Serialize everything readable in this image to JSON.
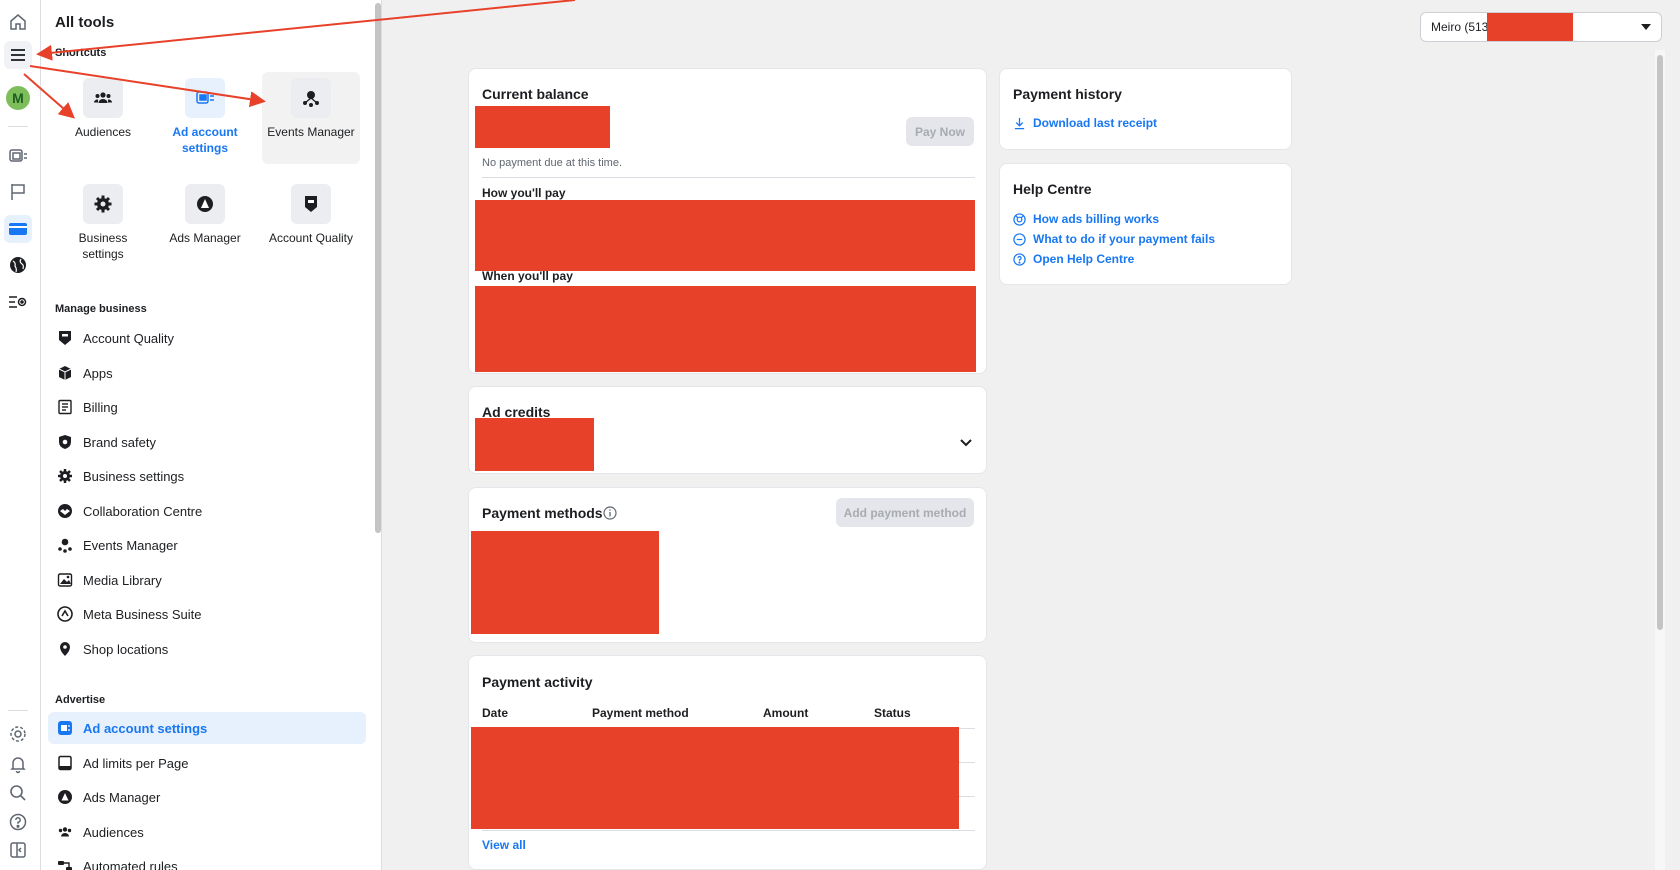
{
  "rail": {
    "avatar_letter": "M",
    "icons": [
      "home-icon",
      "menu-icon",
      "avatar",
      "ad-account-icon",
      "flag-icon",
      "billing-icon",
      "globe-icon",
      "list-settings-icon",
      "settings-icon",
      "bell-icon",
      "search-icon",
      "help-icon",
      "collapse-panel-icon"
    ]
  },
  "tools": {
    "title": "All tools",
    "shortcuts_title": "Shortcuts",
    "shortcuts": [
      {
        "label": "Audiences",
        "icon": "audiences-icon"
      },
      {
        "label": "Ad account settings",
        "icon": "ad-account-settings-icon",
        "active": true
      },
      {
        "label": "Events Manager",
        "icon": "events-manager-icon"
      },
      {
        "label": "Business settings",
        "icon": "gear-icon"
      },
      {
        "label": "Ads Manager",
        "icon": "ads-manager-icon"
      },
      {
        "label": "Account Quality",
        "icon": "shield-icon"
      }
    ],
    "manage_business_title": "Manage business",
    "manage_business": [
      {
        "label": "Account Quality",
        "icon": "shield-icon"
      },
      {
        "label": "Apps",
        "icon": "cube-icon"
      },
      {
        "label": "Billing",
        "icon": "receipt-icon"
      },
      {
        "label": "Brand safety",
        "icon": "brand-safety-icon"
      },
      {
        "label": "Business settings",
        "icon": "gear-icon"
      },
      {
        "label": "Collaboration Centre",
        "icon": "handshake-icon"
      },
      {
        "label": "Events Manager",
        "icon": "events-manager-icon"
      },
      {
        "label": "Media Library",
        "icon": "image-icon"
      },
      {
        "label": "Meta Business Suite",
        "icon": "meta-suite-icon"
      },
      {
        "label": "Shop locations",
        "icon": "pin-icon"
      }
    ],
    "advertise_title": "Advertise",
    "advertise": [
      {
        "label": "Ad account settings",
        "icon": "ad-account-settings-icon",
        "active": true
      },
      {
        "label": "Ad limits per Page",
        "icon": "tablet-icon"
      },
      {
        "label": "Ads Manager",
        "icon": "ads-manager-icon"
      },
      {
        "label": "Audiences",
        "icon": "audiences-icon"
      },
      {
        "label": "Automated rules",
        "icon": "rules-icon"
      }
    ]
  },
  "account_selector": {
    "label": "Meiro (513"
  },
  "balance": {
    "title": "Current balance",
    "pay_now": "Pay Now",
    "no_payment": "No payment due at this time.",
    "how_title": "How you'll pay",
    "when_title": "When you'll pay"
  },
  "credits": {
    "title": "Ad credits"
  },
  "methods": {
    "title": "Payment methods",
    "add_button": "Add payment method"
  },
  "activity": {
    "title": "Payment activity",
    "columns": [
      "Date",
      "Payment method",
      "Amount",
      "Status"
    ],
    "view_all": "View all"
  },
  "history": {
    "title": "Payment history",
    "download": "Download last receipt"
  },
  "help": {
    "title": "Help Centre",
    "links": [
      {
        "label": "How ads billing works",
        "icon": "billing-help-icon"
      },
      {
        "label": "What to do if your payment fails",
        "icon": "minus-circle-icon"
      },
      {
        "label": "Open Help Centre",
        "icon": "question-circle-icon"
      }
    ]
  },
  "colors": {
    "accent": "#1877f2",
    "redaction": "#e8412a",
    "annotation_arrow": "#e8412a"
  }
}
